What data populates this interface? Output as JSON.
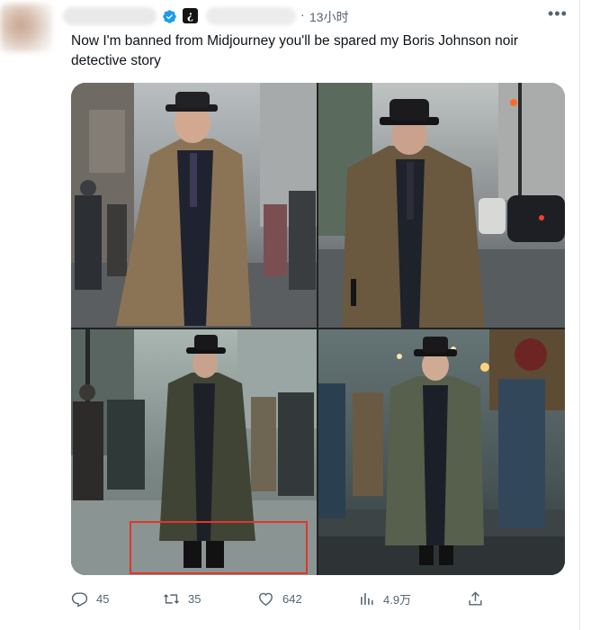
{
  "post": {
    "timestamp": "13小时",
    "separator": "·",
    "handle_badge": "¿",
    "more_label": "•••",
    "text": "Now I'm banned from Midjourney you'll be spared my Boris Johnson noir detective story"
  },
  "media": {
    "images": [
      {
        "label": "image-1"
      },
      {
        "label": "image-2"
      },
      {
        "label": "image-3"
      },
      {
        "label": "image-4"
      }
    ],
    "highlight_color": "#e0362a"
  },
  "actions": {
    "reply_count": "45",
    "retweet_count": "35",
    "like_count": "642",
    "view_count": "4.9万",
    "icons": [
      "reply-icon",
      "retweet-icon",
      "like-icon",
      "views-icon",
      "share-icon"
    ]
  },
  "colors": {
    "text": "#0f1419",
    "muted": "#536471",
    "verified": "#1d9bf0"
  }
}
